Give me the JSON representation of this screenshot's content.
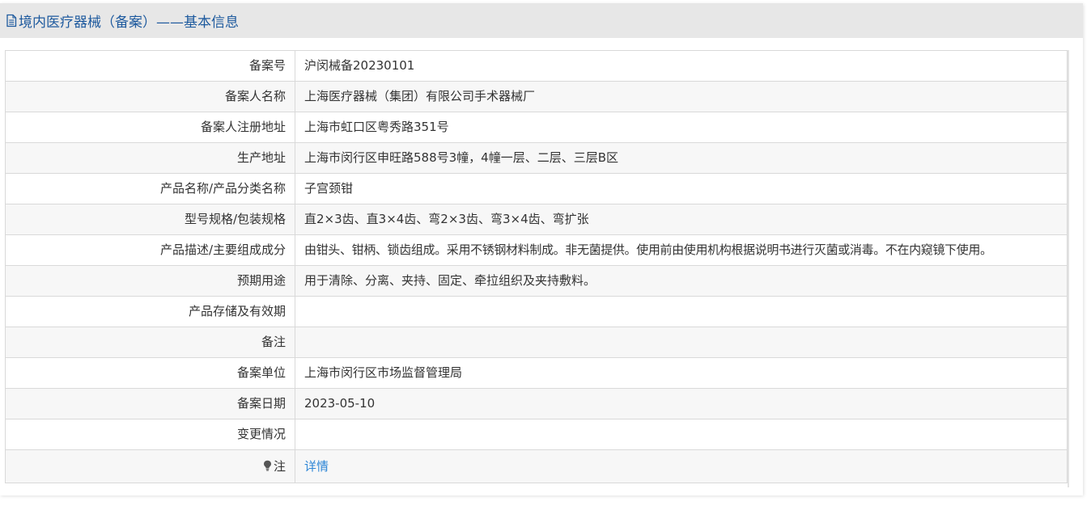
{
  "header": {
    "icon": "document-icon",
    "title": "境内医疗器械（备案）——基本信息",
    "color": "#1e5a9e"
  },
  "rows": [
    {
      "label": "备案号",
      "value": "沪闵械备20230101"
    },
    {
      "label": "备案人名称",
      "value": "上海医疗器械（集团）有限公司手术器械厂"
    },
    {
      "label": "备案人注册地址",
      "value": "上海市虹口区粤秀路351号"
    },
    {
      "label": "生产地址",
      "value": "上海市闵行区申旺路588号3幢，4幢一层、二层、三层B区"
    },
    {
      "label": "产品名称/产品分类名称",
      "value": "子宫颈钳"
    },
    {
      "label": "型号规格/包装规格",
      "value": "直2×3齿、直3×4齿、弯2×3齿、弯3×4齿、弯扩张"
    },
    {
      "label": "产品描述/主要组成成分",
      "value": "由钳头、钳柄、锁齿组成。采用不锈钢材料制成。非无菌提供。使用前由使用机构根据说明书进行灭菌或消毒。不在内窥镜下使用。"
    },
    {
      "label": "预期用途",
      "value": "用于清除、分离、夹持、固定、牵拉组织及夹持敷料。"
    },
    {
      "label": "产品存储及有效期",
      "value": ""
    },
    {
      "label": "备注",
      "value": ""
    },
    {
      "label": "备案单位",
      "value": "上海市闵行区市场监督管理局"
    },
    {
      "label": "备案日期",
      "value": "2023-05-10"
    },
    {
      "label": "变更情况",
      "value": ""
    }
  ],
  "note": {
    "icon": "lightbulb-icon",
    "label": "注",
    "link_text": "详情",
    "link_color": "#2e86d6"
  }
}
